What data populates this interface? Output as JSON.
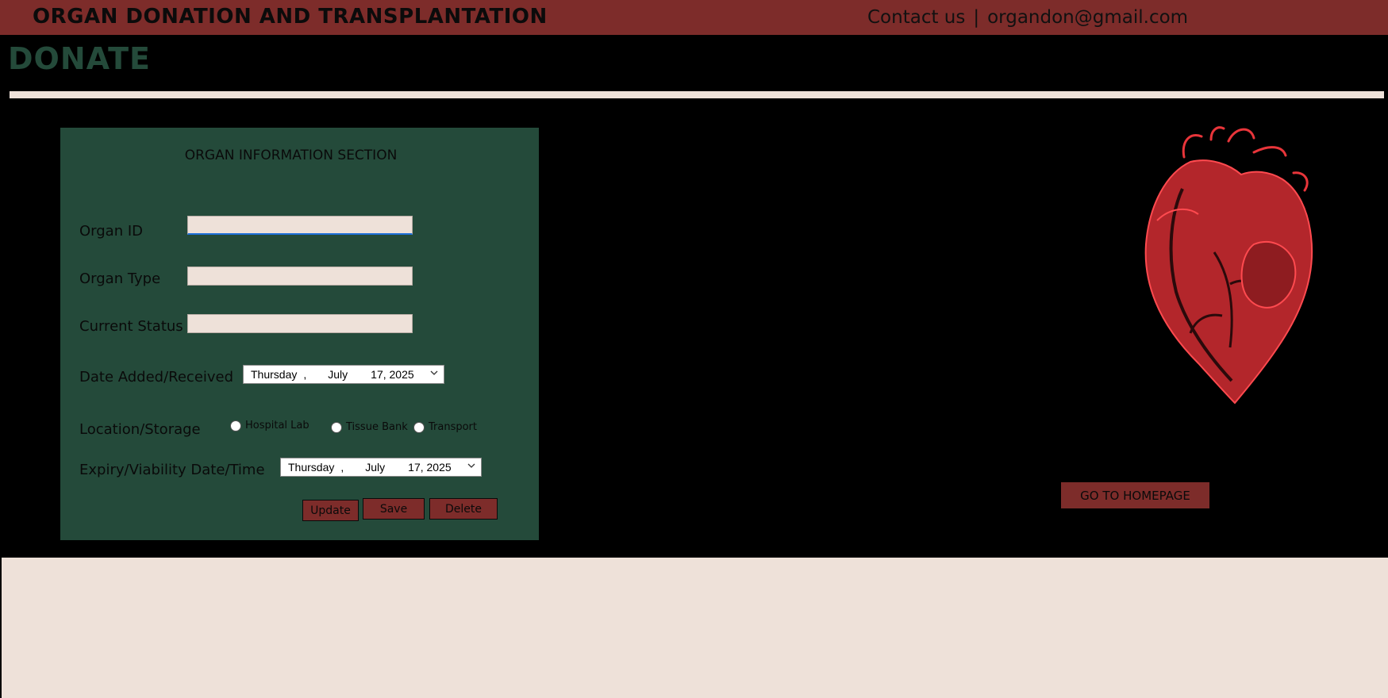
{
  "header": {
    "title": "ORGAN DONATION AND TRANSPLANTATION",
    "contact_label": "Contact us",
    "separator": "|",
    "email": "organdon@gmail.com"
  },
  "page_heading": "DONATE",
  "form": {
    "title": "ORGAN INFORMATION SECTION",
    "organ_id_label": "Organ ID",
    "organ_id_value": "",
    "organ_type_label": "Organ Type",
    "organ_type_value": "",
    "current_status_label": "Current Status",
    "current_status_value": "",
    "date_added_label": "Date Added/Received",
    "date_added": {
      "weekday": "Thursday",
      "comma": ",",
      "month": "July",
      "day_year": "17, 2025"
    },
    "location_label": "Location/Storage",
    "location_options": [
      "Hospital Lab",
      "Tissue Bank",
      "Transport"
    ],
    "expiry_label": "Expiry/Viability Date/Time",
    "expiry_date": {
      "weekday": "Thursday",
      "comma": ",",
      "month": "July",
      "day_year": "17, 2025"
    },
    "buttons": {
      "update": "Update",
      "save": "Save",
      "delete": "Delete"
    }
  },
  "home_button": "GO TO HOMEPAGE",
  "icons": {
    "dropdown": "chevron-down-icon",
    "illustration": "heart-illustration"
  },
  "colors": {
    "header_bg": "#7d2c2a",
    "panel_bg": "#244a3a",
    "heading": "#244a3a",
    "field_bg": "#eee1d9",
    "button_bg": "#7d2c2a",
    "heart": "#e8353a"
  }
}
